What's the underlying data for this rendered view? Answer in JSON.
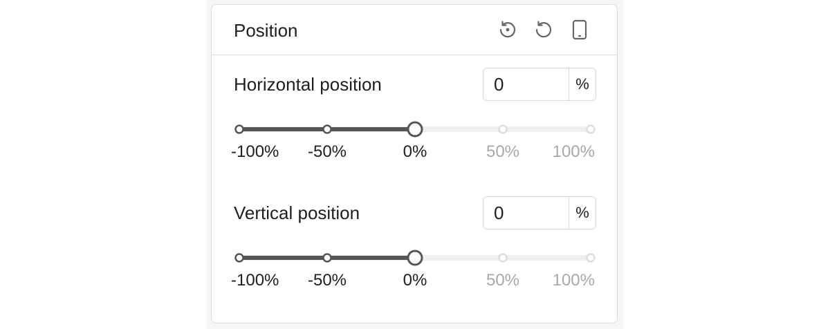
{
  "panel": {
    "title": "Position",
    "icons": [
      "global-reset-icon",
      "reset-icon",
      "device-mobile-icon"
    ]
  },
  "controls": [
    {
      "id": "horizontal",
      "label": "Horizontal position",
      "value": "0",
      "unit": "%",
      "slider": {
        "min": -100,
        "max": 100,
        "current": 0
      },
      "ticks": [
        "-100%",
        "-50%",
        "0%",
        "50%",
        "100%"
      ]
    },
    {
      "id": "vertical",
      "label": "Vertical position",
      "value": "0",
      "unit": "%",
      "slider": {
        "min": -100,
        "max": 100,
        "current": 0
      },
      "ticks": [
        "-100%",
        "-50%",
        "0%",
        "50%",
        "100%"
      ]
    }
  ],
  "colors": {
    "track_active": "#555555",
    "track_inactive": "#efefef",
    "tick_inactive": "#dddddd",
    "text": "#1e1e1e",
    "text_muted": "#a8a8a8",
    "border": "#dddddd"
  }
}
